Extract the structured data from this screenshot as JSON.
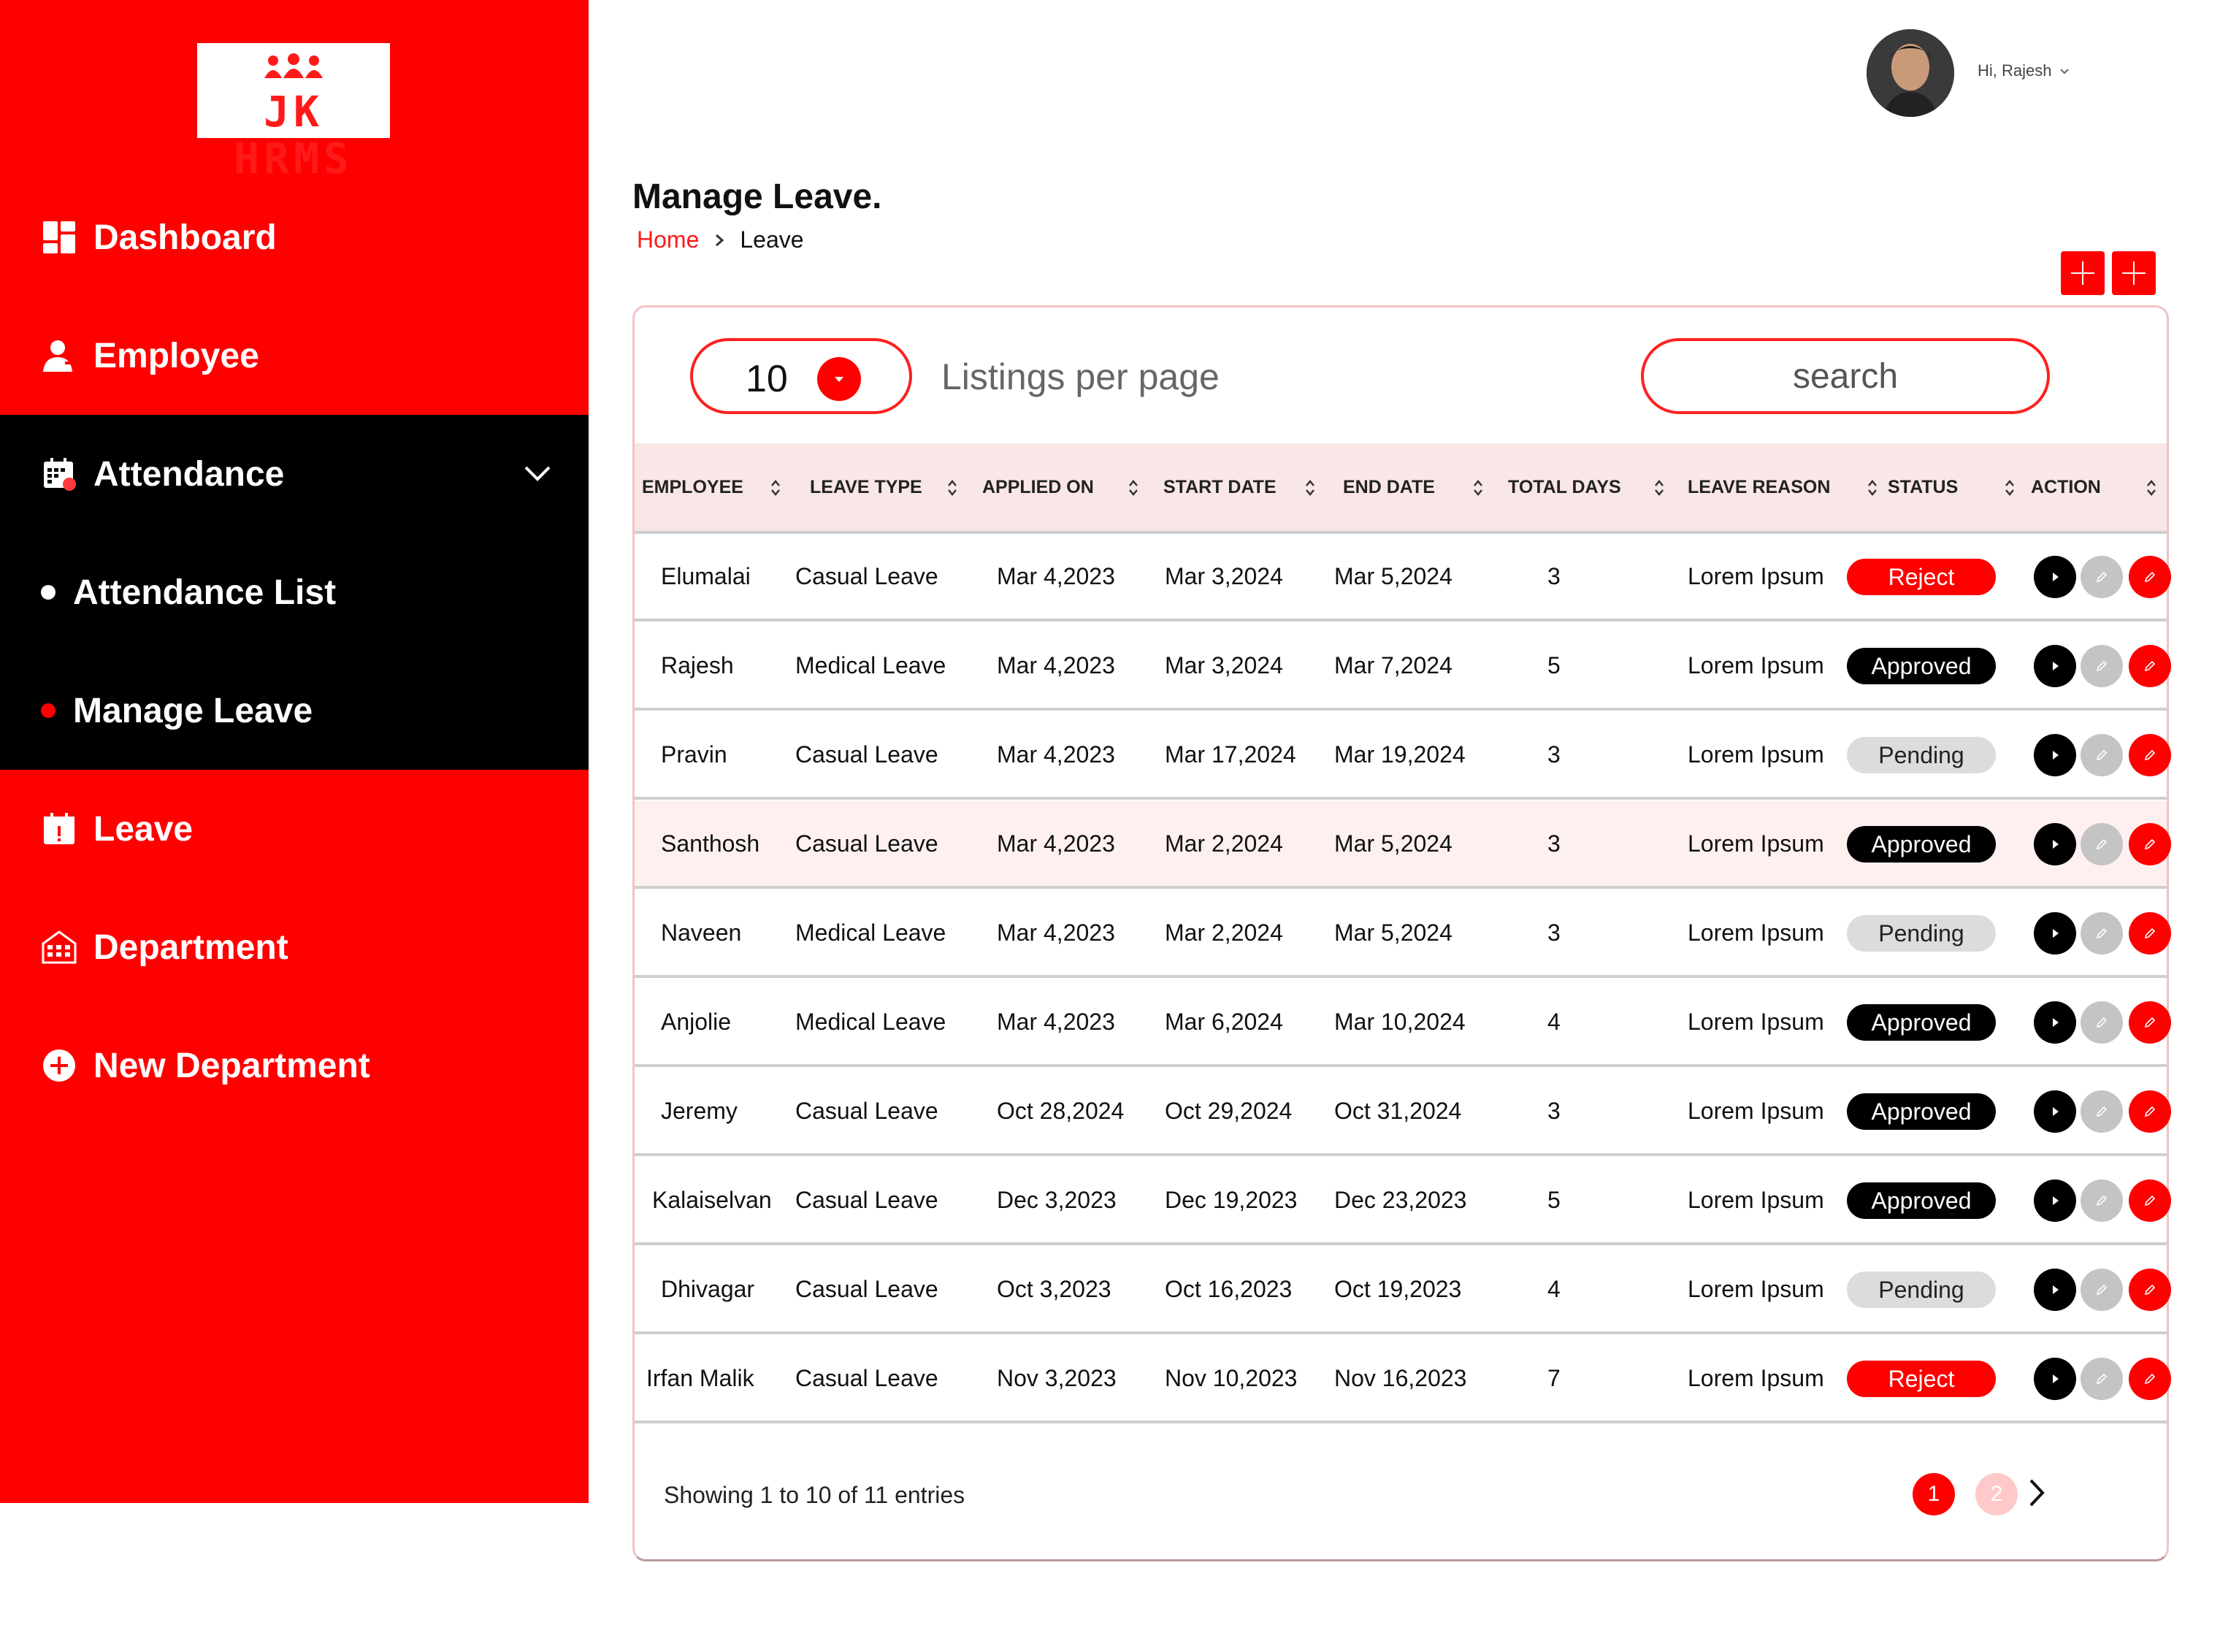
{
  "app": {
    "logo_text": "JK HRMS",
    "brand_color": "#ff0000"
  },
  "sidebar": {
    "items": [
      {
        "label": "Dashboard",
        "icon": "dashboard-icon"
      },
      {
        "label": "Employee",
        "icon": "person-icon"
      },
      {
        "label": "Attendance",
        "icon": "calendar-grid-icon",
        "expanded": true
      },
      {
        "label": "Attendance List",
        "icon": "bullet-white"
      },
      {
        "label": "Manage Leave",
        "icon": "bullet-red",
        "active": true
      },
      {
        "label": "Leave",
        "icon": "calendar-alert-icon"
      },
      {
        "label": "Department",
        "icon": "building-icon"
      },
      {
        "label": "New Department",
        "icon": "plus-circle-icon"
      }
    ]
  },
  "header": {
    "greeting": "Hi, Rajesh"
  },
  "page": {
    "title": "Manage Leave.",
    "breadcrumb": {
      "home": "Home",
      "current": "Leave"
    }
  },
  "controls": {
    "per_page_value": "10",
    "per_page_label": "Listings per page",
    "search_placeholder": "search"
  },
  "table": {
    "columns": [
      "EMPLOYEE",
      "LEAVE TYPE",
      "APPLIED ON",
      "START DATE",
      "END DATE",
      "TOTAL DAYS",
      "LEAVE REASON",
      "STATUS",
      "ACTION"
    ],
    "rows": [
      {
        "employee": "Elumalai",
        "leave_type": "Casual Leave",
        "applied_on": "Mar 4,2023",
        "start_date": "Mar 3,2024",
        "end_date": "Mar 5,2024",
        "total_days": "3",
        "reason": "Lorem Ipsum",
        "status": "Reject"
      },
      {
        "employee": "Rajesh",
        "leave_type": "Medical Leave",
        "applied_on": "Mar 4,2023",
        "start_date": "Mar 3,2024",
        "end_date": "Mar 7,2024",
        "total_days": "5",
        "reason": "Lorem Ipsum",
        "status": "Approved"
      },
      {
        "employee": "Pravin",
        "leave_type": "Casual Leave",
        "applied_on": "Mar 4,2023",
        "start_date": "Mar 17,2024",
        "end_date": "Mar 19,2024",
        "total_days": "3",
        "reason": "Lorem Ipsum",
        "status": "Pending"
      },
      {
        "employee": "Santhosh",
        "leave_type": "Casual Leave",
        "applied_on": "Mar 4,2023",
        "start_date": "Mar 2,2024",
        "end_date": "Mar 5,2024",
        "total_days": "3",
        "reason": "Lorem Ipsum",
        "status": "Approved"
      },
      {
        "employee": "Naveen",
        "leave_type": "Medical Leave",
        "applied_on": "Mar 4,2023",
        "start_date": "Mar 2,2024",
        "end_date": "Mar 5,2024",
        "total_days": "3",
        "reason": "Lorem Ipsum",
        "status": "Pending"
      },
      {
        "employee": "Anjolie",
        "leave_type": "Medical Leave",
        "applied_on": "Mar 4,2023",
        "start_date": "Mar 6,2024",
        "end_date": "Mar 10,2024",
        "total_days": "4",
        "reason": "Lorem Ipsum",
        "status": "Approved"
      },
      {
        "employee": "Jeremy",
        "leave_type": "Casual Leave",
        "applied_on": "Oct 28,2024",
        "start_date": "Oct 29,2024",
        "end_date": "Oct 31,2024",
        "total_days": "3",
        "reason": "Lorem Ipsum",
        "status": "Approved"
      },
      {
        "employee": "Kalaiselvan",
        "leave_type": "Casual Leave",
        "applied_on": "Dec 3,2023",
        "start_date": "Dec 19,2023",
        "end_date": "Dec 23,2023",
        "total_days": "5",
        "reason": "Lorem Ipsum",
        "status": "Approved"
      },
      {
        "employee": "Dhivagar",
        "leave_type": "Casual Leave",
        "applied_on": "Oct 3,2023",
        "start_date": "Oct 16,2023",
        "end_date": "Oct 19,2023",
        "total_days": "4",
        "reason": "Lorem Ipsum",
        "status": "Pending"
      },
      {
        "employee": "Irfan Malik",
        "leave_type": "Casual Leave",
        "applied_on": "Nov 3,2023",
        "start_date": "Nov 10,2023",
        "end_date": "Nov 16,2023",
        "total_days": "7",
        "reason": "Lorem Ipsum",
        "status": "Reject"
      }
    ],
    "status_colors": {
      "Reject": {
        "bg": "#ff0000",
        "fg": "#ffffff"
      },
      "Approved": {
        "bg": "#000000",
        "fg": "#ffffff"
      },
      "Pending": {
        "bg": "#dcdcdc",
        "fg": "#222222"
      }
    }
  },
  "footer": {
    "showing": "Showing 1 to 10 of 11 entries",
    "pages": [
      "1",
      "2"
    ],
    "current_page": "1"
  }
}
